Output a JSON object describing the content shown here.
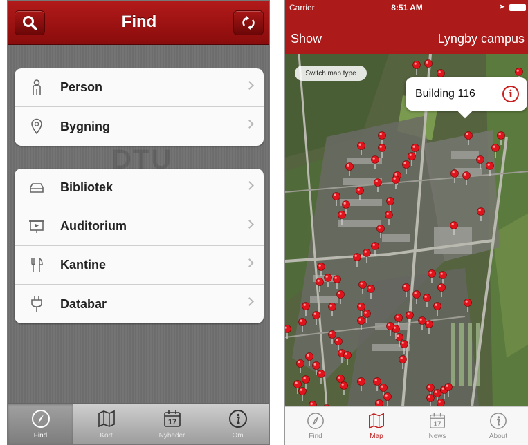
{
  "find_screen": {
    "title": "Find",
    "watermark": "DTU",
    "groups": [
      [
        {
          "label": "Person",
          "icon": "person-icon"
        },
        {
          "label": "Bygning",
          "icon": "location-pin-icon"
        }
      ],
      [
        {
          "label": "Bibliotek",
          "icon": "library-icon"
        },
        {
          "label": "Auditorium",
          "icon": "projector-screen-icon"
        },
        {
          "label": "Kantine",
          "icon": "cutlery-icon"
        },
        {
          "label": "Databar",
          "icon": "power-plug-icon"
        }
      ]
    ],
    "tabs": [
      {
        "label": "Find",
        "icon": "compass-icon",
        "active": true
      },
      {
        "label": "Kort",
        "icon": "map-icon",
        "active": false
      },
      {
        "label": "Nyheder",
        "icon": "calendar-icon",
        "active": false
      },
      {
        "label": "Om",
        "icon": "info-icon",
        "active": false
      }
    ],
    "calendar_day": "17"
  },
  "map_screen": {
    "status": {
      "carrier": "Carrier",
      "time": "8:51 AM"
    },
    "show_label": "Show",
    "campus_label": "Lyngby campus",
    "switch_map_type": "Switch map type",
    "callout": {
      "title": "Building 116"
    },
    "tabs": [
      {
        "label": "Find",
        "icon": "compass-icon",
        "active": false
      },
      {
        "label": "Map",
        "icon": "map-icon",
        "active": true
      },
      {
        "label": "News",
        "icon": "calendar-icon",
        "active": false
      },
      {
        "label": "About",
        "icon": "info-icon",
        "active": false
      }
    ],
    "calendar_day": "17"
  },
  "colors": {
    "brand_red": "#ad1a1a",
    "pin_red": "#e0141c",
    "active_tab_red": "#c01f1f"
  }
}
